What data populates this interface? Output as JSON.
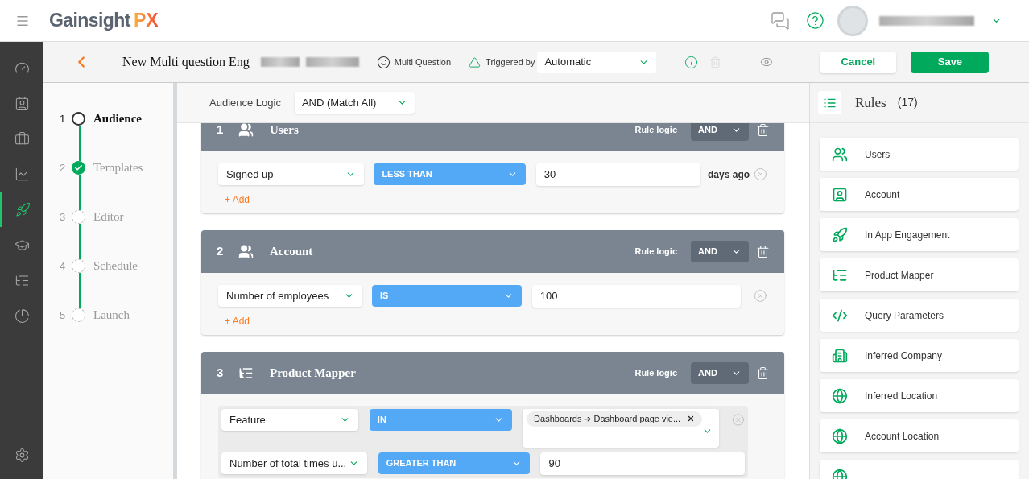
{
  "header": {
    "logo_word": "Gainsight",
    "logo_badge": "PX"
  },
  "nav": [
    {
      "kind": "gauge",
      "selected": false
    },
    {
      "kind": "contact",
      "selected": false
    },
    {
      "kind": "briefcase",
      "selected": false
    },
    {
      "kind": "chart",
      "selected": false
    },
    {
      "kind": "rocket",
      "selected": true
    },
    {
      "kind": "cap",
      "selected": false
    },
    {
      "kind": "tree",
      "selected": false
    },
    {
      "kind": "pie",
      "selected": false
    }
  ],
  "toolbar": {
    "title": "New Multi question Eng",
    "type_label": "Multi Question",
    "trigger_label": "Triggered by",
    "trigger_value": "Automatic",
    "delete_disabled": true,
    "cancel": "Cancel",
    "save": "Save"
  },
  "steps": [
    {
      "number": "1",
      "label": "Audience",
      "kind": "current"
    },
    {
      "number": "2",
      "label": "Templates",
      "kind": "done"
    },
    {
      "number": "3",
      "label": "Editor",
      "kind": "pending"
    },
    {
      "number": "4",
      "label": "Schedule",
      "kind": "pending"
    },
    {
      "number": "5",
      "label": "Launch",
      "kind": "pending"
    }
  ],
  "audience_logic": {
    "label": "Audience Logic",
    "value": "AND (Match All)"
  },
  "rule_groups": [
    {
      "number": "1",
      "kind": "users",
      "title": "Users",
      "logic_label": "Rule logic",
      "logic": "AND",
      "nested": false,
      "add": "+ Add",
      "rows": [
        {
          "attribute": "Signed up",
          "operator": "LESS THAN",
          "value": "30",
          "suffix": "days ago",
          "removable": true
        }
      ]
    },
    {
      "number": "2",
      "kind": "users",
      "title": "Account",
      "logic_label": "Rule logic",
      "logic": "AND",
      "nested": false,
      "add": "+ Add",
      "rows": [
        {
          "attribute": "Number of employees",
          "operator": "IS",
          "value": "100",
          "removable": true
        }
      ]
    },
    {
      "number": "3",
      "kind": "mapper",
      "title": "Product Mapper",
      "logic_label": "Rule logic",
      "logic": "AND",
      "nested": true,
      "rows": [
        {
          "attribute": "Feature",
          "operator": "IN",
          "tags": [
            "Dashboards ➔ Dashboard page vie..."
          ],
          "removable": true
        },
        {
          "attribute": "Number of total times u...",
          "operator": "GREATER THAN",
          "value": "90",
          "removable": false
        }
      ]
    }
  ],
  "rules_panel": {
    "title": "Rules",
    "count": "(17)",
    "items": [
      {
        "kind": "users",
        "label": "Users"
      },
      {
        "kind": "account",
        "label": "Account"
      },
      {
        "kind": "rocket",
        "label": "In App Engagement"
      },
      {
        "kind": "mapper",
        "label": "Product Mapper"
      },
      {
        "kind": "query",
        "label": "Query Parameters"
      },
      {
        "kind": "company",
        "label": "Inferred Company"
      },
      {
        "kind": "globe",
        "label": "Inferred Location"
      },
      {
        "kind": "globe",
        "label": "Account Location"
      },
      {
        "kind": "globe"
      }
    ]
  }
}
